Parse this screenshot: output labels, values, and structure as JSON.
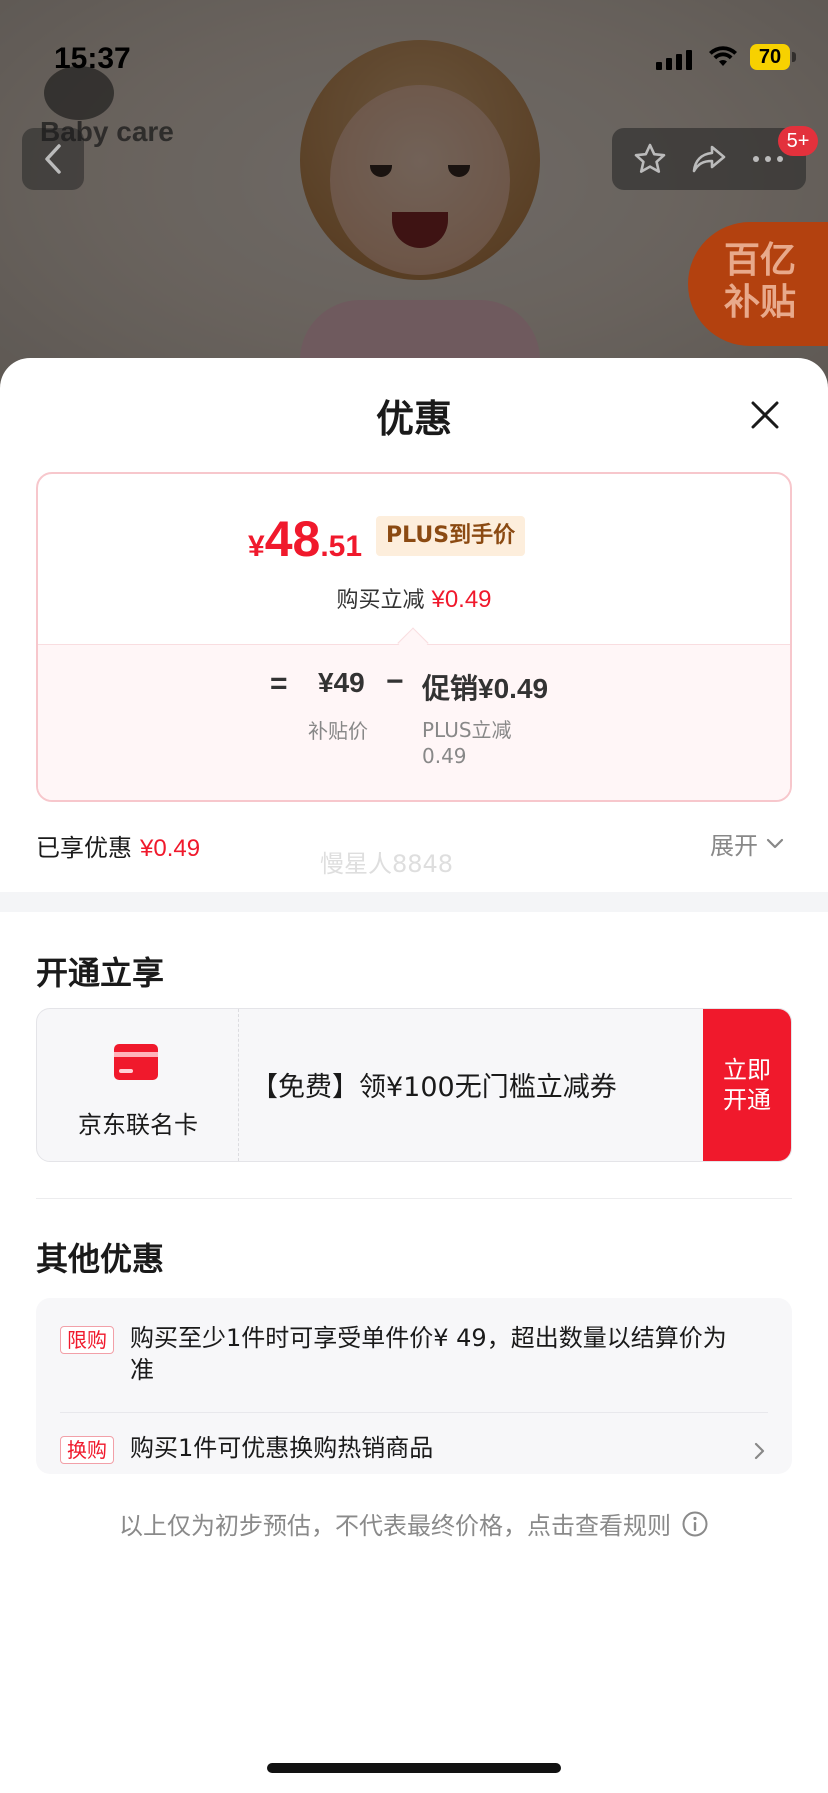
{
  "status_bar": {
    "time": "15:37",
    "battery": "70"
  },
  "background": {
    "brand": "Baby care",
    "nav_badge": "5+",
    "subsidy_line1": "百亿",
    "subsidy_line2": "补贴"
  },
  "sheet": {
    "title": "优惠",
    "price": {
      "currency": "¥",
      "integer": "48",
      "decimal": ".51",
      "tag": "PLUS到手价"
    },
    "instant_reduction": {
      "label": "购买立减",
      "amount": "¥0.49"
    },
    "breakdown": {
      "equals": "=",
      "subsidy_price": "¥49",
      "subsidy_label": "补贴价",
      "minus": "−",
      "promo_label": "促销",
      "promo_value": "¥0.49",
      "promo_sub_line1": "PLUS立减",
      "promo_sub_line2": "0.49"
    },
    "enjoyed": {
      "label": "已享优惠",
      "amount": "¥0.49"
    },
    "expand_label": "展开",
    "watermark": "慢星人8848",
    "open_section": {
      "title": "开通立享",
      "card_name": "京东联名卡",
      "offer": "【免费】领¥100无门槛立减券",
      "button": "立即开通"
    },
    "other_section": {
      "title": "其他优惠",
      "rows": [
        {
          "tag": "限购",
          "text": "购买至少1件时可享受单件价¥ 49，超出数量以结算价为准"
        },
        {
          "tag": "换购",
          "text": "购买1件可优惠换购热销商品"
        }
      ]
    },
    "disclaimer": "以上仅为初步预估，不代表最终价格，点击查看规则"
  },
  "colors": {
    "accent_red": "#f0192c",
    "plus_tag_bg": "#fdeedc",
    "plus_tag_text": "#8b4a12"
  }
}
